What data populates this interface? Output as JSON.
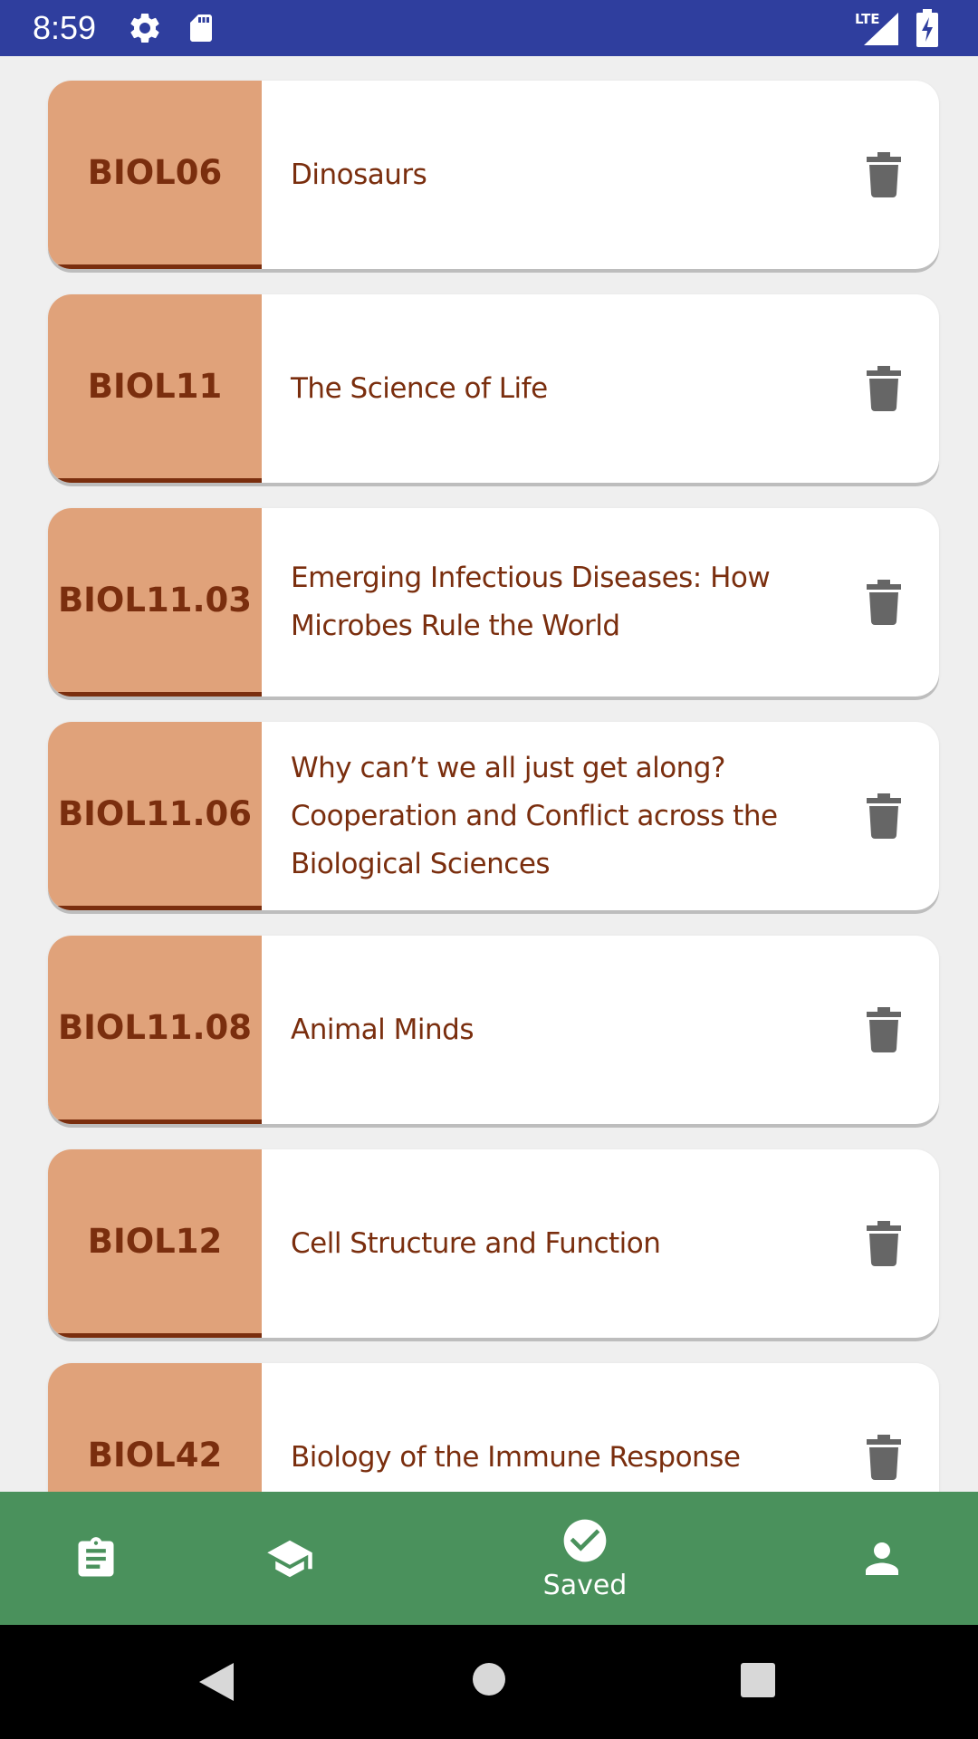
{
  "status_bar": {
    "time": "8:59",
    "network": "LTE",
    "background_color": "#2f3e9e",
    "icons": [
      "gear-icon",
      "sd-card-icon",
      "signal-icon",
      "battery-charging-icon"
    ]
  },
  "courses": [
    {
      "code": "BIOL06",
      "title": "Dinosaurs"
    },
    {
      "code": "BIOL11",
      "title": "The Science of Life"
    },
    {
      "code": "BIOL11.03",
      "title": "Emerging Infectious Diseases: How Microbes Rule the World"
    },
    {
      "code": "BIOL11.06",
      "title": "Why can’t we all just get along? Cooperation and Conflict across the Biological Sciences"
    },
    {
      "code": "BIOL11.08",
      "title": "Animal Minds"
    },
    {
      "code": "BIOL12",
      "title": "Cell Structure and Function"
    },
    {
      "code": "BIOL42",
      "title": "Biology of the Immune Response"
    }
  ],
  "bottom_nav": {
    "background_color": "#4a915c",
    "items": [
      {
        "icon": "clipboard-icon",
        "label": ""
      },
      {
        "icon": "graduation-cap-icon",
        "label": ""
      },
      {
        "icon": "check-circle-icon",
        "label": "Saved",
        "selected": true
      },
      {
        "icon": "person-icon",
        "label": ""
      }
    ]
  },
  "colors": {
    "code_background": "#e0a27a",
    "text_brown": "#7a2e0e",
    "delete_icon": "#666666",
    "page_background": "#efefef"
  }
}
